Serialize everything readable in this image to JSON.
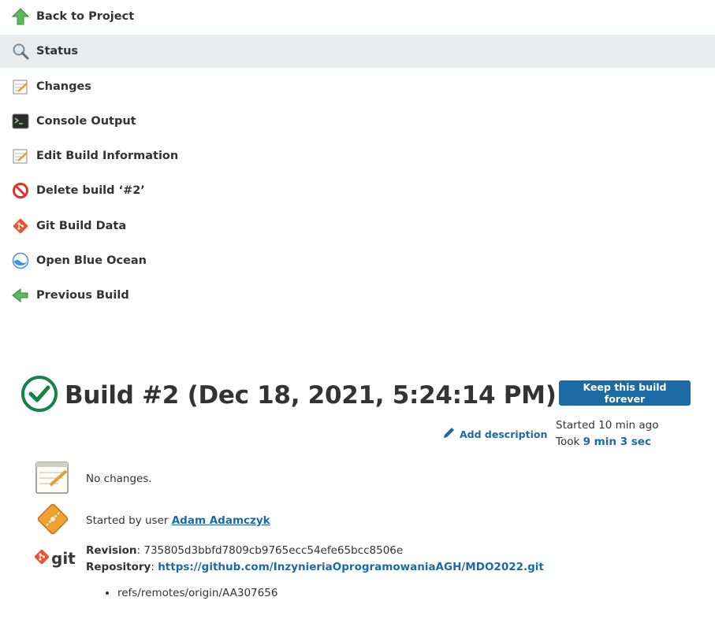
{
  "sidebar": {
    "items": [
      {
        "label": "Back to Project",
        "icon": "up-arrow-icon"
      },
      {
        "label": "Status",
        "icon": "magnifier-icon"
      },
      {
        "label": "Changes",
        "icon": "notepad-icon"
      },
      {
        "label": "Console Output",
        "icon": "terminal-icon"
      },
      {
        "label": "Edit Build Information",
        "icon": "notepad-icon"
      },
      {
        "label": "Delete build ‘#2’",
        "icon": "no-entry-icon"
      },
      {
        "label": "Git Build Data",
        "icon": "git-icon"
      },
      {
        "label": "Open Blue Ocean",
        "icon": "blue-ocean-icon"
      },
      {
        "label": "Previous Build",
        "icon": "left-arrow-icon"
      }
    ]
  },
  "build": {
    "title": "Build #2 (Dec 18, 2021, 5:24:14 PM)",
    "status_icon": "success-check-icon",
    "keep_forever_label": "Keep this build forever",
    "started_text": "Started 10 min ago",
    "took_prefix": "Took ",
    "took_duration": "9 min 3 sec",
    "add_description_label": "Add description"
  },
  "summary": {
    "changes_text": "No changes.",
    "started_by_prefix": "Started by user ",
    "started_by_user": "Adam Adamczyk",
    "revision_label": "Revision",
    "revision_value": "735805d3bbfd7809cb9765ecc54efe65bcc8506e",
    "repository_label": "Repository",
    "repository_url": "https://github.com/InzynieriaOprogramowaniaAGH/MDO2022.git",
    "refs": [
      "refs/remotes/origin/AA307656"
    ],
    "git_logo_text": "git"
  },
  "colors": {
    "accent": "#1b6aa5",
    "success": "#138347",
    "active_bg": "#e9ecef",
    "text": "#333333"
  }
}
